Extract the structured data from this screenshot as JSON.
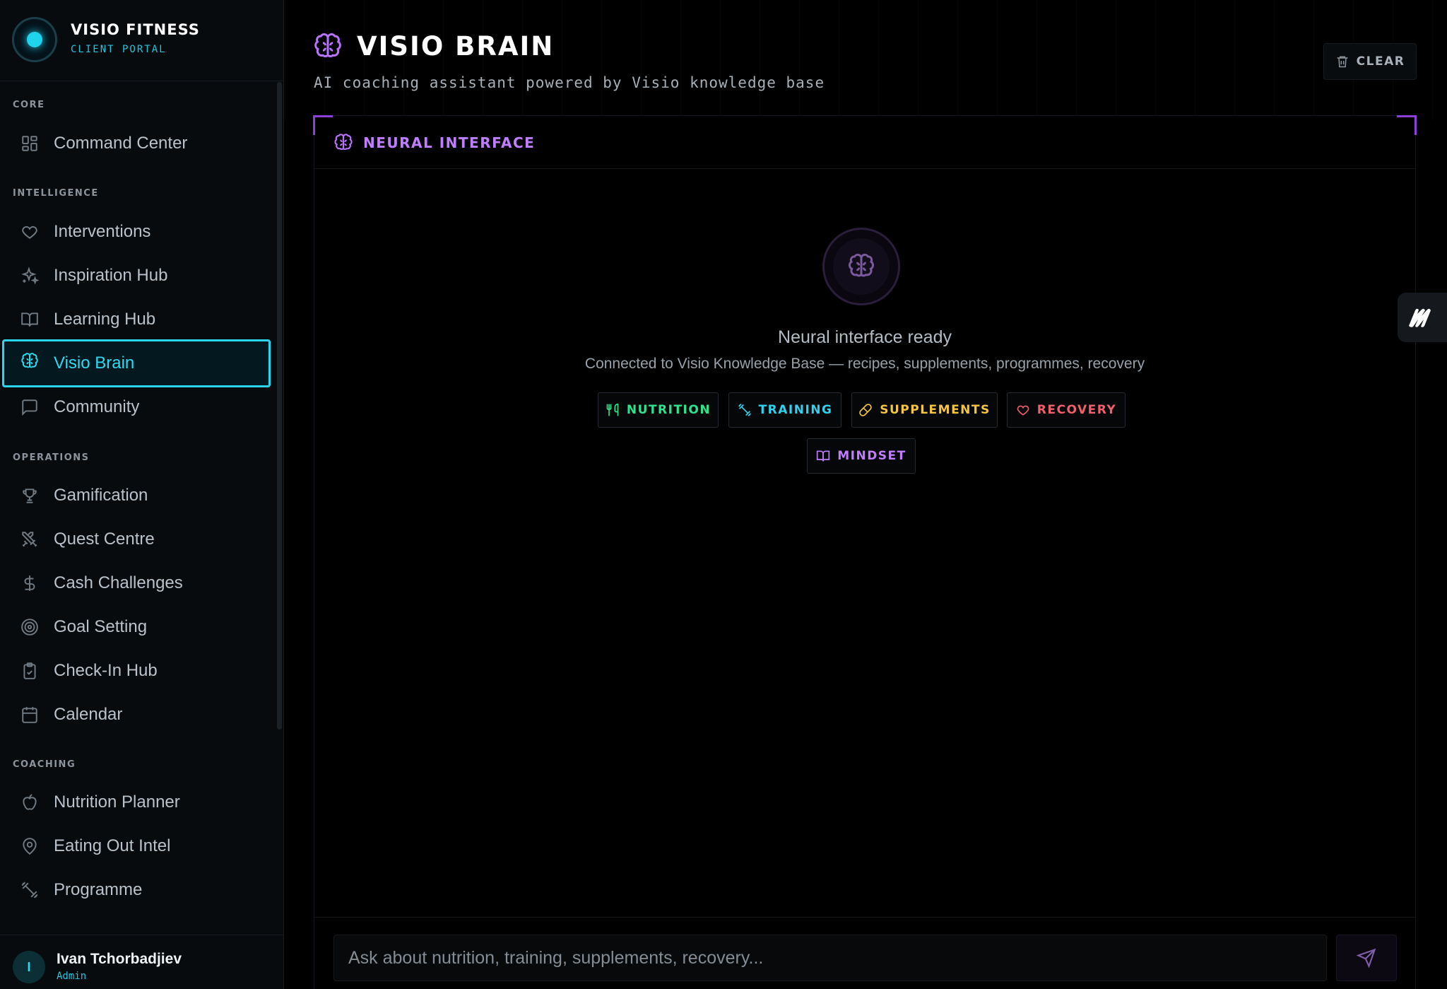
{
  "brand": {
    "name": "VISIO FITNESS",
    "subtitle": "CLIENT PORTAL"
  },
  "sidebar": {
    "sections": [
      {
        "label": "CORE"
      },
      {
        "label": "INTELLIGENCE"
      },
      {
        "label": "OPERATIONS"
      },
      {
        "label": "COACHING"
      }
    ],
    "items": [
      {
        "label": "Command Center",
        "icon": "grid-icon"
      },
      {
        "label": "Interventions",
        "icon": "heart-icon"
      },
      {
        "label": "Inspiration Hub",
        "icon": "sparkles-icon"
      },
      {
        "label": "Learning Hub",
        "icon": "book-open-icon"
      },
      {
        "label": "Visio Brain",
        "icon": "brain-icon",
        "active": true
      },
      {
        "label": "Community",
        "icon": "message-square-icon"
      },
      {
        "label": "Gamification",
        "icon": "trophy-icon"
      },
      {
        "label": "Quest Centre",
        "icon": "swords-icon"
      },
      {
        "label": "Cash Challenges",
        "icon": "dollar-icon"
      },
      {
        "label": "Goal Setting",
        "icon": "target-icon"
      },
      {
        "label": "Check-In Hub",
        "icon": "clipboard-check-icon"
      },
      {
        "label": "Calendar",
        "icon": "calendar-icon"
      },
      {
        "label": "Nutrition Planner",
        "icon": "apple-icon"
      },
      {
        "label": "Eating Out Intel",
        "icon": "map-pin-icon"
      },
      {
        "label": "Programme",
        "icon": "dumbbell-icon"
      }
    ]
  },
  "user": {
    "initial": "I",
    "name": "Ivan Tchorbadjiev",
    "role": "Admin"
  },
  "header": {
    "title": "VISIO BRAIN",
    "subtitle": "AI coaching assistant powered by Visio knowledge base",
    "clear_label": "CLEAR"
  },
  "panel": {
    "title": "NEURAL INTERFACE",
    "ready_text": "Neural interface ready",
    "connected_text": "Connected to Visio Knowledge Base — recipes, supplements, programmes, recovery"
  },
  "topics": [
    {
      "label": "NUTRITION",
      "icon": "utensils-icon",
      "color": "#2ee28f"
    },
    {
      "label": "TRAINING",
      "icon": "dumbbell-icon",
      "color": "#2fd1ef"
    },
    {
      "label": "SUPPLEMENTS",
      "icon": "pill-icon",
      "color": "#f5c53d"
    },
    {
      "label": "RECOVERY",
      "icon": "heart-icon",
      "color": "#f25f6c"
    },
    {
      "label": "MINDSET",
      "icon": "book-open-icon",
      "color": "#c07dff"
    }
  ],
  "chat": {
    "placeholder": "Ask about nutrition, training, supplements, recovery..."
  },
  "colors": {
    "accent_cyan": "#2ad6ef",
    "accent_purple": "#b974ff",
    "background": "#000000"
  }
}
